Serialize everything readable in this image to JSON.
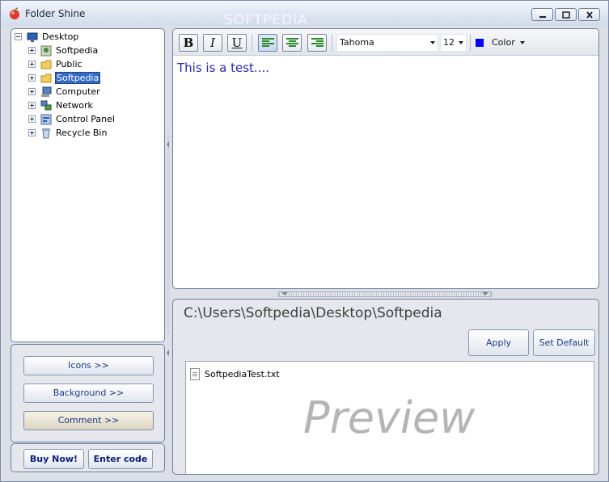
{
  "window": {
    "title": "Folder Shine",
    "watermark": "SOFTPEDIA",
    "controls": [
      "minimize-icon",
      "maximize-icon",
      "close-icon"
    ]
  },
  "tree": {
    "items": [
      {
        "label": "Desktop",
        "icon": "desktop-icon",
        "expander": "minus"
      },
      {
        "label": "Softpedia",
        "icon": "user-folder-icon",
        "expander": "plus"
      },
      {
        "label": "Public",
        "icon": "folder-icon",
        "expander": "plus"
      },
      {
        "label": "Softpedia",
        "icon": "folder-icon",
        "expander": "plus",
        "selected": true
      },
      {
        "label": "Computer",
        "icon": "computer-icon",
        "expander": "plus"
      },
      {
        "label": "Network",
        "icon": "network-icon",
        "expander": "plus"
      },
      {
        "label": "Control Panel",
        "icon": "control-panel-icon",
        "expander": "plus"
      },
      {
        "label": "Recycle Bin",
        "icon": "recycle-bin-icon",
        "expander": "plus"
      }
    ]
  },
  "side_buttons": {
    "icons": "Icons >>",
    "background": "Background >>",
    "comment": "Comment >>",
    "active": "comment"
  },
  "buy": {
    "buy_now": "Buy Now!",
    "enter_code": "Enter code"
  },
  "editor": {
    "bold": "B",
    "italic": "I",
    "underline": "U",
    "alignment": "left",
    "font": "Tahoma",
    "size": "12",
    "color_label": "Color",
    "color_value": "#0000ff",
    "text": "This is a test...."
  },
  "bottom": {
    "path": "C:\\Users\\Softpedia\\Desktop\\Softpedia",
    "apply": "Apply",
    "set_default": "Set Default",
    "file_name": "SoftpediaTest.txt",
    "preview_label": "Preview"
  },
  "colors": {
    "accent": "#316ac5",
    "button_text": "#1e3a8a",
    "editor_text": "#2a2ab0"
  }
}
